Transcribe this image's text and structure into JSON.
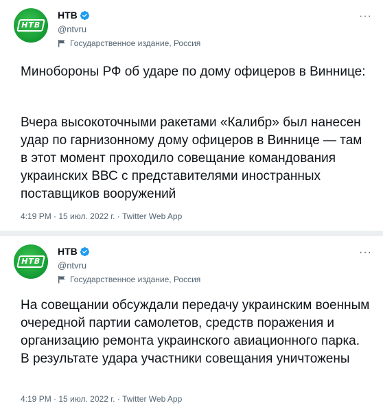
{
  "tweets": [
    {
      "author_name": "НТВ",
      "handle": "@ntvru",
      "account_label": "Государственное издание, Россия",
      "avatar_text": "НТВ",
      "paragraphs": [
        "Минобороны РФ об ударе по дому офицеров в Виннице:",
        "Вчера высокоточными ракетами «Калибр» был нанесен удар по гарнизонному дому офицеров в Виннице — там в этот момент проходило совещание командования украинских ВВС с представителями иностранных поставщиков вооружений"
      ],
      "time": "4:19 PM",
      "date": "15 июл. 2022 г.",
      "source": "Twitter Web App"
    },
    {
      "author_name": "НТВ",
      "handle": "@ntvru",
      "account_label": "Государственное издание, Россия",
      "avatar_text": "НТВ",
      "paragraphs": [
        "На совещании обсуждали передачу украинским военным очередной партии самолетов, средств поражения и организацию ремонта украинского авиационного парка. В результате удара участники совещания уничтожены"
      ],
      "time": "4:19 PM",
      "date": "15 июл. 2022 г.",
      "source": "Twitter Web App"
    }
  ],
  "separator": " · ",
  "colors": {
    "brand_green": "#139a33",
    "verified_blue": "#1d9bf0",
    "muted_text": "#536471",
    "separator_bg": "#eceff1"
  },
  "icons": {
    "verified": "verified-badge-icon",
    "government": "government-label-icon",
    "more": "more-options-icon"
  }
}
